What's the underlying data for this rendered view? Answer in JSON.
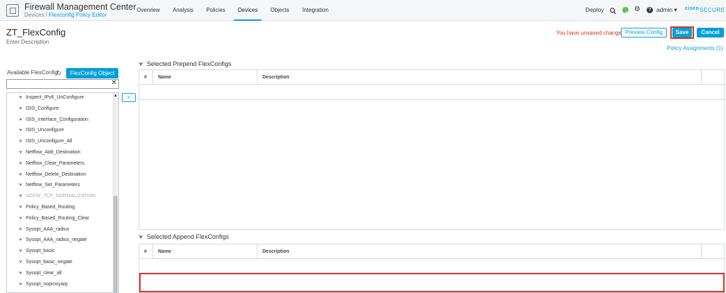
{
  "header": {
    "app_title": "Firewall Management Center",
    "breadcrumb_root": "Devices",
    "breadcrumb_sep": " / ",
    "breadcrumb_current": "Flexconfig Policy Editor",
    "nav": [
      "Overview",
      "Analysis",
      "Policies",
      "Devices",
      "Objects",
      "Integration"
    ],
    "active_nav": "Devices",
    "deploy": "Deploy",
    "user": "admin ▾",
    "brand_cisco": "cisco",
    "brand_secure": "SECURE",
    "icons": [
      "search-icon",
      "status-ok-icon",
      "gear-icon",
      "help-icon"
    ]
  },
  "page": {
    "title": "ZT_FlexConfig",
    "description": "Enter Description",
    "unsaved": "You have unsaved changes",
    "preview_label": "Preview Config",
    "save_label": "Save",
    "cancel_label": "Cancel",
    "policy_assignments": "Policy Assignments (1)"
  },
  "available": {
    "label": "Available FlexConfig",
    "object_button": "FlexConfig Object",
    "search_value": "",
    "move_button": ">",
    "items": [
      {
        "label": "Inspect_IPv6_UnConfigure",
        "disabled": false
      },
      {
        "label": "ISIS_Configure",
        "disabled": false
      },
      {
        "label": "ISIS_Interface_Configuration",
        "disabled": false
      },
      {
        "label": "ISIS_Unconfigure",
        "disabled": false
      },
      {
        "label": "ISIS_Unconfigure_All",
        "disabled": false
      },
      {
        "label": "Netflow_Add_Destination",
        "disabled": false
      },
      {
        "label": "Netflow_Clear_Parameters",
        "disabled": false
      },
      {
        "label": "Netflow_Delete_Destination",
        "disabled": false
      },
      {
        "label": "Netflow_Set_Parameters",
        "disabled": false
      },
      {
        "label": "NGFW_TCP_NORMALIZATION",
        "disabled": true
      },
      {
        "label": "Policy_Based_Routing",
        "disabled": false
      },
      {
        "label": "Policy_Based_Routing_Clear",
        "disabled": false
      },
      {
        "label": "Sysopt_AAA_radius",
        "disabled": false
      },
      {
        "label": "Sysopt_AAA_radius_negate",
        "disabled": false
      },
      {
        "label": "Sysopt_basic",
        "disabled": false
      },
      {
        "label": "Sysopt_basic_negate",
        "disabled": false
      },
      {
        "label": "Sysopt_clear_all",
        "disabled": false
      },
      {
        "label": "Sysopt_noproxyarp",
        "disabled": false
      }
    ]
  },
  "prepend": {
    "title": "Selected Prepend FlexConfigs",
    "columns": [
      "#",
      "Name",
      "Description"
    ]
  },
  "append": {
    "title": "Selected Append FlexConfigs",
    "columns": [
      "#",
      "Name",
      "Description"
    ]
  },
  "colors": {
    "accent": "#049fd9",
    "alert": "#d93025",
    "status_ok": "#6abf4b"
  }
}
